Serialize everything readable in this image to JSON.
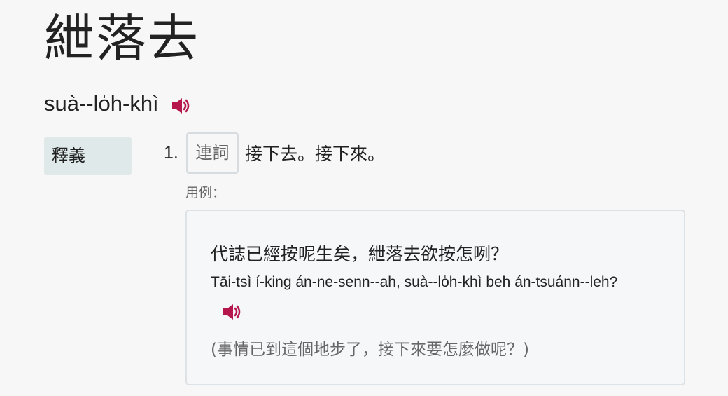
{
  "entry": {
    "headword": "紲落去",
    "romanization": "suà--lo̍h-khì",
    "audio_icon": "speaker-icon",
    "accent_color": "#b5164b"
  },
  "senses_section": {
    "label": "釋義",
    "senses": [
      {
        "number": "1.",
        "part_of_speech": "連詞",
        "definition": "接下去。接下來。",
        "example_label": "用例：",
        "examples": [
          {
            "han": "代誌已經按呢生矣，紲落去欲按怎咧？",
            "romanization": "Tāi-tsì í-king án-ne-senn--ah, suà--lo̍h-khì beh án-tsuánn--leh?",
            "audio_icon": "speaker-icon",
            "translation": "(事情已到這個地步了，接下來要怎麼做呢？)"
          }
        ]
      }
    ]
  }
}
